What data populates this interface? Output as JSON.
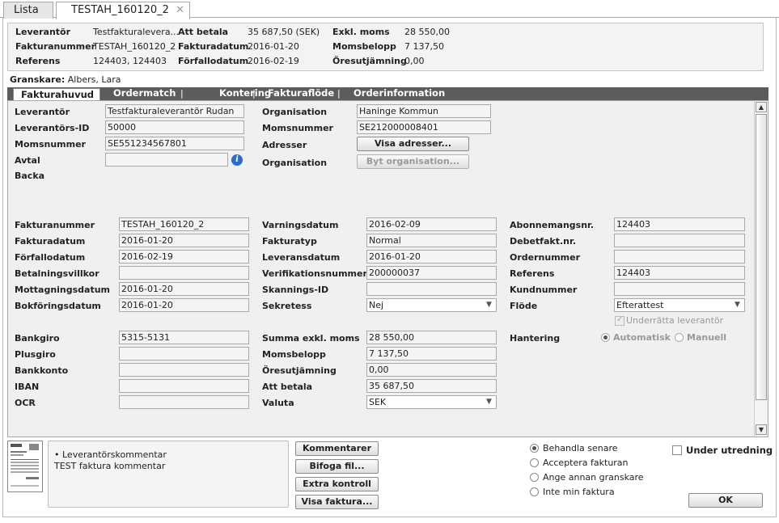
{
  "top_tabs": [
    {
      "label": "Lista"
    },
    {
      "label": "TESTAH_160120_2"
    }
  ],
  "summary": {
    "leverantor_label": "Leverantör",
    "leverantor_value": "Testfakturalevera...",
    "fakturanummer_label": "Fakturanummer",
    "fakturanummer_value": "TESTAH_160120_2",
    "referens_label": "Referens",
    "referens_value": "124403, 124403",
    "att_betala_label": "Att betala",
    "att_betala_value": "35 687,50 (SEK)",
    "fakturadatum_label": "Fakturadatum",
    "fakturadatum_value": "2016-01-20",
    "forfallodatum_label": "Förfallodatum",
    "forfallodatum_value": "2016-02-19",
    "exkl_moms_label": "Exkl. moms",
    "exkl_moms_value": "28 550,00",
    "momsbelopp_label": "Momsbelopp",
    "momsbelopp_value": "7 137,50",
    "oresutjamning_label": "Öresutjämning",
    "oresutjamning_value": "0,00"
  },
  "granskare": {
    "label": "Granskare:",
    "value": "Albers, Lara"
  },
  "sub_tabs": [
    {
      "label": "Fakturahuvud"
    },
    {
      "label": "Ordermatch"
    },
    {
      "label": "Kontering"
    },
    {
      "label": "Fakturaflöde"
    },
    {
      "label": "Orderinformation"
    }
  ],
  "separator": "|",
  "header_section": {
    "leverantor_label": "Leverantör",
    "leverantor_value": "Testfakturaleverantör Rudan",
    "leverantors_id_label": "Leverantörs-ID",
    "leverantors_id_value": "50000",
    "momsnummer_label": "Momsnummer",
    "momsnummer_value": "SE551234567801",
    "avtal_label": "Avtal",
    "avtal_value": "",
    "backa_label": "Backa",
    "organisation_label": "Organisation",
    "organisation_value": "Haninge Kommun",
    "org_momsnummer_label": "Momsnummer",
    "org_momsnummer_value": "SE212000008401",
    "adresser_label": "Adresser",
    "visa_adresser_button": "Visa adresser...",
    "organisation2_label": "Organisation",
    "byt_organisation_button": "Byt organisation..."
  },
  "col1": [
    {
      "label": "Fakturanummer",
      "value": "TESTAH_160120_2"
    },
    {
      "label": "Fakturadatum",
      "value": "2016-01-20"
    },
    {
      "label": "Förfallodatum",
      "value": "2016-02-19"
    },
    {
      "label": "Betalningsvillkor",
      "value": ""
    },
    {
      "label": "Mottagningsdatum",
      "value": "2016-01-20"
    },
    {
      "label": "Bokföringsdatum",
      "value": "2016-01-20"
    }
  ],
  "col2": [
    {
      "label": "Varningsdatum",
      "value": "2016-02-09"
    },
    {
      "label": "Fakturatyp",
      "value": "Normal"
    },
    {
      "label": "Leveransdatum",
      "value": "2016-01-20"
    },
    {
      "label": "Verifikationsnummer",
      "value": "200000037"
    },
    {
      "label": "Skannings-ID",
      "value": ""
    },
    {
      "label": "Sekretess",
      "value": "Nej"
    }
  ],
  "col3": [
    {
      "label": "Abonnemangsnr.",
      "value": "124403"
    },
    {
      "label": "Debetfakt.nr.",
      "value": ""
    },
    {
      "label": "Ordernummer",
      "value": ""
    },
    {
      "label": "Referens",
      "value": "124403"
    },
    {
      "label": "Kundnummer",
      "value": ""
    },
    {
      "label": "Flöde",
      "value": "Efterattest"
    }
  ],
  "underratta_label": "Underrätta leverantör",
  "col1b": [
    {
      "label": "Bankgiro",
      "value": "5315-5131"
    },
    {
      "label": "Plusgiro",
      "value": ""
    },
    {
      "label": "Bankkonto",
      "value": ""
    },
    {
      "label": "IBAN",
      "value": ""
    },
    {
      "label": "OCR",
      "value": ""
    }
  ],
  "col2b": [
    {
      "label": "Summa exkl. moms",
      "value": "28 550,00"
    },
    {
      "label": "Momsbelopp",
      "value": "7 137,50"
    },
    {
      "label": "Öresutjämning",
      "value": "0,00"
    },
    {
      "label": "Att betala",
      "value": "35 687,50"
    },
    {
      "label": "Valuta",
      "value": "SEK"
    }
  ],
  "hantering": {
    "label": "Hantering",
    "automatisk": "Automatisk",
    "manuell": "Manuell"
  },
  "comment": {
    "line1": "• Leverantörskommentar",
    "line2": "TEST faktura kommentar"
  },
  "buttons": {
    "kommentarer": "Kommentarer",
    "bifoga": "Bifoga fil...",
    "extra": "Extra kontroll",
    "visa_faktura": "Visa faktura..."
  },
  "actions": [
    {
      "label": "Behandla senare",
      "selected": true
    },
    {
      "label": "Acceptera fakturan",
      "selected": false
    },
    {
      "label": "Ange annan granskare",
      "selected": false
    },
    {
      "label": "Inte min faktura",
      "selected": false
    }
  ],
  "under_utredning": "Under utredning",
  "ok_button": "OK"
}
